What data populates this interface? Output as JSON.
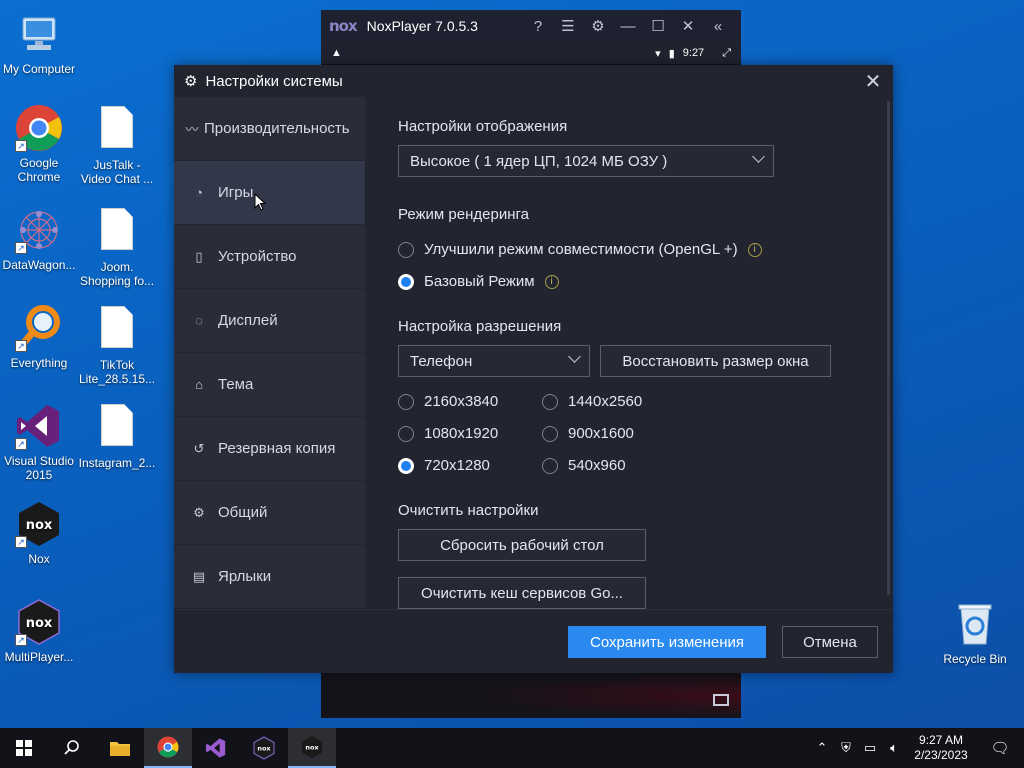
{
  "desktop": {
    "icons": [
      {
        "label": "My Computer",
        "icon": "computer-icon"
      },
      {
        "label": "Google Chrome",
        "icon": "chrome-icon"
      },
      {
        "label": "JusTalk - Video Chat ...",
        "icon": "document-icon"
      },
      {
        "label": "DataWagon...",
        "icon": "datawagon-icon"
      },
      {
        "label": "Joom. Shopping fo...",
        "icon": "document-icon"
      },
      {
        "label": "Everything",
        "icon": "everything-search-icon"
      },
      {
        "label": "TikTok Lite_28.5.15...",
        "icon": "document-icon"
      },
      {
        "label": "Visual Studio 2015",
        "icon": "visual-studio-icon"
      },
      {
        "label": "Instagram_2...",
        "icon": "document-icon"
      },
      {
        "label": "Nox",
        "icon": "nox-icon"
      },
      {
        "label": "MultiPlayer...",
        "icon": "nox-multiplayer-icon"
      },
      {
        "label": "Recycle Bin",
        "icon": "recycle-bin-icon"
      }
    ]
  },
  "nox": {
    "logo": "nox",
    "title": "NoxPlayer 7.0.5.3",
    "status_time": "9:27"
  },
  "dialog": {
    "title": "Настройки системы",
    "sidebar": [
      {
        "label": "Производительность",
        "icon": "performance-icon"
      },
      {
        "label": "Игры",
        "icon": "games-icon"
      },
      {
        "label": "Устройство",
        "icon": "device-icon"
      },
      {
        "label": "Дисплей",
        "icon": "display-icon"
      },
      {
        "label": "Тема",
        "icon": "theme-icon"
      },
      {
        "label": "Резервная копия",
        "icon": "backup-icon"
      },
      {
        "label": "Общий",
        "icon": "general-icon"
      },
      {
        "label": "Ярлыки",
        "icon": "shortcuts-icon"
      }
    ],
    "display_settings": {
      "title": "Настройки отображения",
      "selected": "Высокое ( 1 ядер ЦП, 1024 МБ ОЗУ )"
    },
    "render_mode": {
      "title": "Режим рендеринга",
      "options": [
        {
          "label": "Улучшили режим совместимости (OpenGL +)",
          "checked": false
        },
        {
          "label": "Базовый Режим",
          "checked": true
        }
      ]
    },
    "resolution": {
      "title": "Настройка разрешения",
      "device_selected": "Телефон",
      "restore_button": "Восстановить размер окна",
      "options": [
        {
          "label": "2160x3840",
          "checked": false
        },
        {
          "label": "1440x2560",
          "checked": false
        },
        {
          "label": "1080x1920",
          "checked": false
        },
        {
          "label": "900x1600",
          "checked": false
        },
        {
          "label": "720x1280",
          "checked": true
        },
        {
          "label": "540x960",
          "checked": false
        }
      ]
    },
    "clear": {
      "title": "Очистить настройки",
      "reset_desktop": "Сбросить рабочий стол",
      "clear_cache": "Очистить кеш сервисов Go..."
    },
    "footer": {
      "save": "Сохранить изменения",
      "cancel": "Отмена"
    },
    "accent_color": "#2a8af0"
  },
  "taskbar": {
    "time": "9:27 AM",
    "date": "2/23/2023"
  }
}
